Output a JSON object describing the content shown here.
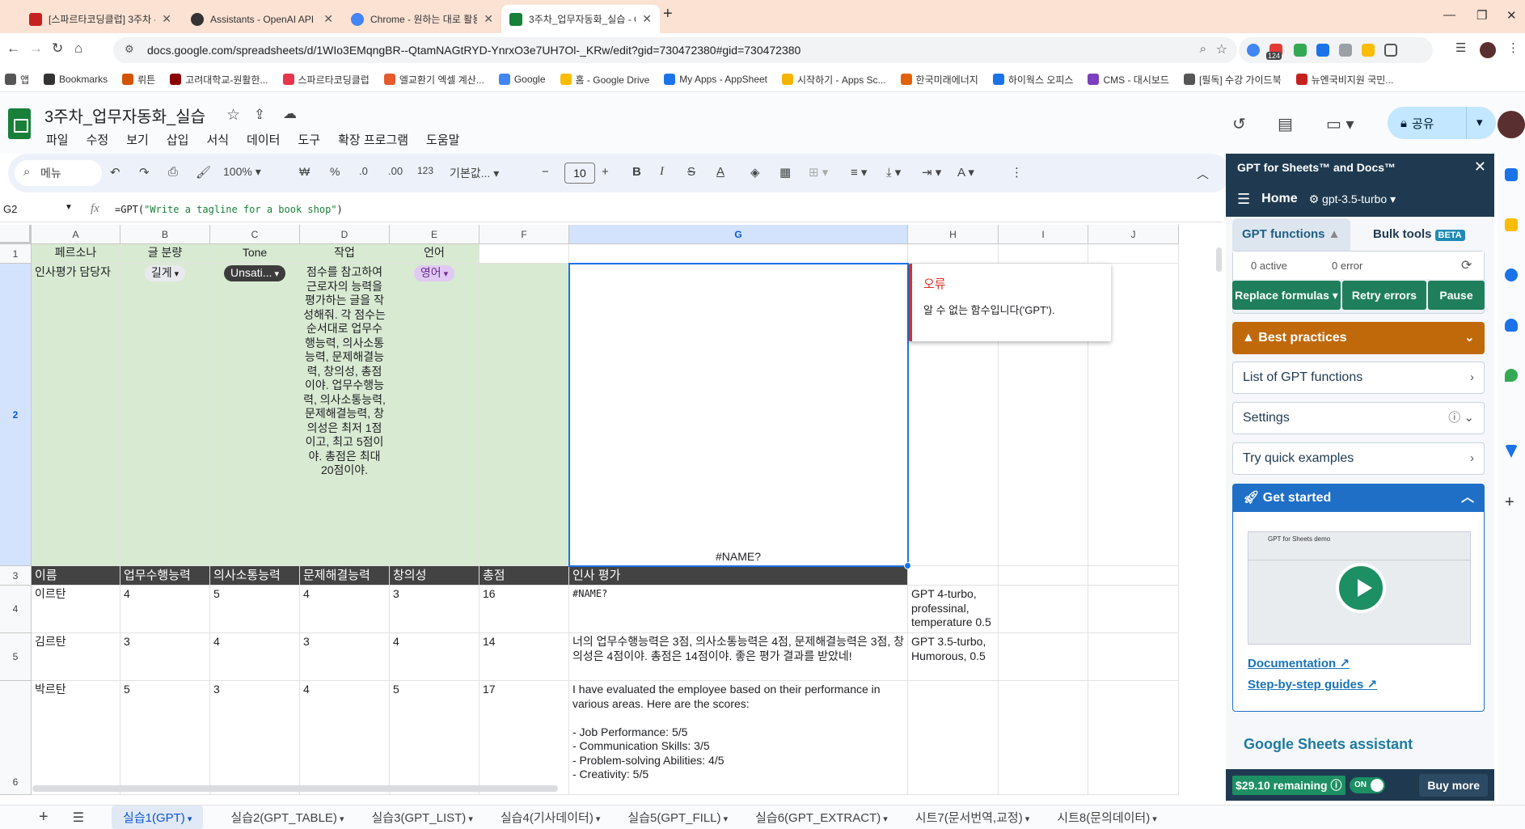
{
  "browser": {
    "tabs": [
      {
        "title": "[스파르타코딩클럽] 3주차 - GP",
        "color": "#c5221f",
        "active": false
      },
      {
        "title": "Assistants - OpenAI API",
        "color": "#333333",
        "active": false
      },
      {
        "title": "Chrome - 원하는 대로 활용할",
        "color": "#4285f4",
        "active": false
      },
      {
        "title": "3주차_업무자동화_실습 - Goog",
        "color": "#188038",
        "active": true
      }
    ],
    "url": "docs.google.com/spreadsheets/d/1WIo3EMqngBR--QtamNAGtRYD-YnrxO3e7UH7Ol-_KRw/edit?gid=730472380#gid=730472380",
    "extension_badge": "124",
    "bookmarks": [
      {
        "label": "앱",
        "color": "#555555"
      },
      {
        "label": "Bookmarks",
        "color": "#333333"
      },
      {
        "label": "뤼튼",
        "color": "#d35400"
      },
      {
        "label": "고려대학교-원활한...",
        "color": "#8b0000"
      },
      {
        "label": "스파르타코딩클럽",
        "color": "#e5374b"
      },
      {
        "label": "엘교환기 엑셀 계산...",
        "color": "#e55b2b"
      },
      {
        "label": "Google",
        "color": "#4285f4"
      },
      {
        "label": "홈 - Google Drive",
        "color": "#fbbc04"
      },
      {
        "label": "My Apps - AppSheet",
        "color": "#1a73e8"
      },
      {
        "label": "시작하기 - Apps Sc...",
        "color": "#f4b400"
      },
      {
        "label": "한국미래에너지",
        "color": "#e36209"
      },
      {
        "label": "하이웍스 오피스",
        "color": "#1a73e8"
      },
      {
        "label": "CMS - 대시보드",
        "color": "#7b3fbf"
      },
      {
        "label": "[필독] 수강 가이드북",
        "color": "#555555"
      },
      {
        "label": "뉴엔국비지원 국민...",
        "color": "#c5221f"
      }
    ]
  },
  "doc": {
    "title": "3주차_업무자동화_실습",
    "menu": [
      "파일",
      "수정",
      "보기",
      "삽입",
      "서식",
      "데이터",
      "도구",
      "확장 프로그램",
      "도움말"
    ],
    "share_label": "공유"
  },
  "toolbar": {
    "menu_search": "메뉴",
    "zoom": "100%",
    "currency": "₩",
    "percent": "%",
    "dec_decrease": ".0",
    "dec_increase": ".00",
    "number_format": "123",
    "font": "기본값...",
    "font_size": "10"
  },
  "formula_bar": {
    "cell_ref": "G2",
    "fx": "fx",
    "formula_prefix": "=GPT(",
    "formula_string": "\"Write a tagline for a book shop\"",
    "formula_suffix": ")"
  },
  "grid": {
    "columns": [
      "A",
      "B",
      "C",
      "D",
      "E",
      "F",
      "G",
      "H",
      "I",
      "J"
    ],
    "rows": [
      "1",
      "2",
      "3",
      "4",
      "5",
      "6"
    ],
    "row1": [
      "페르소나",
      "글 분량",
      "Tone",
      "작업",
      "언어"
    ],
    "row2": {
      "persona": "인사평가 담당자",
      "length_chip": "길게",
      "tone_chip": "Unsati...",
      "task": "점수를 참고하여 근로자의 능력을 평가하는 글을 작성해줘. 각 점수는 순서대로 업무수행능력, 의사소통능력, 문제해결능력, 창의성, 총점이야. 업무수행능력, 의사소통능력, 문제해결능력, 창의성은 최저 1점이고, 최고 5점이야. 총점은 최대 20점이야.",
      "lang_chip": "영어",
      "g2": "#NAME?"
    },
    "row3": [
      "이름",
      "업무수행능력",
      "의사소통능력",
      "문제해결능력",
      "창의성",
      "총점",
      "인사 평가"
    ],
    "data_rows": [
      {
        "name": "이르탄",
        "vals": [
          "4",
          "5",
          "4",
          "3",
          "16"
        ],
        "eval": "#NAME?",
        "h": "GPT 4-turbo, professinal, temperature 0.5"
      },
      {
        "name": "김르탄",
        "vals": [
          "3",
          "4",
          "3",
          "4",
          "14"
        ],
        "eval": "너의 업무수행능력은 3점, 의사소통능력은 4점, 문제해결능력은 3점, 창의성은 4점이야. 총점은 14점이야. 좋은 평가 결과를 받았네!",
        "h": "GPT 3.5-turbo, Humorous, 0.5"
      },
      {
        "name": "박르탄",
        "vals": [
          "5",
          "3",
          "4",
          "5",
          "17"
        ],
        "eval": "I have evaluated the employee based on their performance in various areas. Here are the scores:\n\n- Job Performance: 5/5\n- Communication Skills: 3/5\n- Problem-solving Abilities: 4/5\n- Creativity: 5/5",
        "h": ""
      }
    ],
    "error_popup": {
      "title": "오류",
      "message": "알 수 없는 함수입니다('GPT')."
    }
  },
  "sheet_tabs": [
    "실습1(GPT)",
    "실습2(GPT_TABLE)",
    "실습3(GPT_LIST)",
    "실습4(기사데이터)",
    "실습5(GPT_FILL)",
    "실습6(GPT_EXTRACT)",
    "시트7(문서번역,교정)",
    "시트8(문의데이터)"
  ],
  "sidebar": {
    "title": "GPT for Sheets™ and Docs™",
    "home": "Home",
    "model": "gpt-3.5-turbo",
    "tab_functions": "GPT functions",
    "tab_bulk": "Bulk tools",
    "beta": "BETA",
    "active_count": "0 active",
    "error_count": "0 error",
    "btn_replace": "Replace formulas",
    "btn_retry": "Retry errors",
    "btn_pause": "Pause",
    "best_practices": "Best practices",
    "list_functions": "List of GPT functions",
    "settings": "Settings",
    "quick_examples": "Try quick examples",
    "get_started": "Get started",
    "video_title": "GPT for Sheets demo",
    "documentation": "Documentation",
    "step_guides": "Step-by-step guides",
    "assistant": "Google Sheets assistant",
    "remaining": "$29.10 remaining",
    "toggle": "ON",
    "buy_more": "Buy more"
  }
}
